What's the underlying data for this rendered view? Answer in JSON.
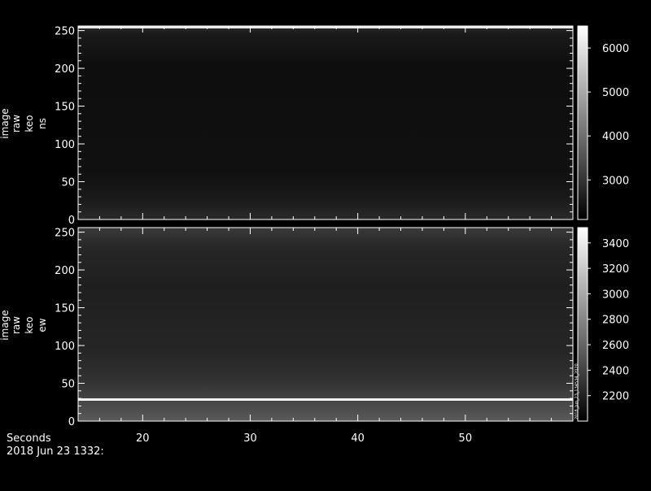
{
  "x_axis_label": "Seconds",
  "timestamp": "2018 Jun 23 1332:",
  "x_ticks": [
    20,
    30,
    40,
    50
  ],
  "x_range": [
    14,
    60
  ],
  "colors": {
    "background": "#000000",
    "axes": "#ffffff"
  },
  "chart_data": [
    {
      "type": "heatmap",
      "panel": "top",
      "ylabel": [
        "image",
        "raw",
        "keo",
        "ns"
      ],
      "ylim": [
        0,
        256
      ],
      "y_ticks": [
        0,
        50,
        100,
        150,
        200,
        250
      ],
      "colorbar": {
        "range": [
          2100,
          6500
        ],
        "ticks": [
          3000,
          4000,
          5000,
          6000
        ]
      },
      "bright_rows": [
        254
      ]
    },
    {
      "type": "heatmap",
      "panel": "bottom",
      "ylabel": [
        "image",
        "raw",
        "keo",
        "ew"
      ],
      "ylim": [
        0,
        256
      ],
      "y_ticks": [
        0,
        50,
        100,
        150,
        200,
        250
      ],
      "colorbar": {
        "range": [
          2000,
          3520
        ],
        "ticks": [
          2200,
          2400,
          2600,
          2800,
          3000,
          3200,
          3400
        ]
      },
      "bright_rows": [
        26
      ],
      "colorbar_annotation": "2018_Jun_23_134534_2020"
    }
  ]
}
